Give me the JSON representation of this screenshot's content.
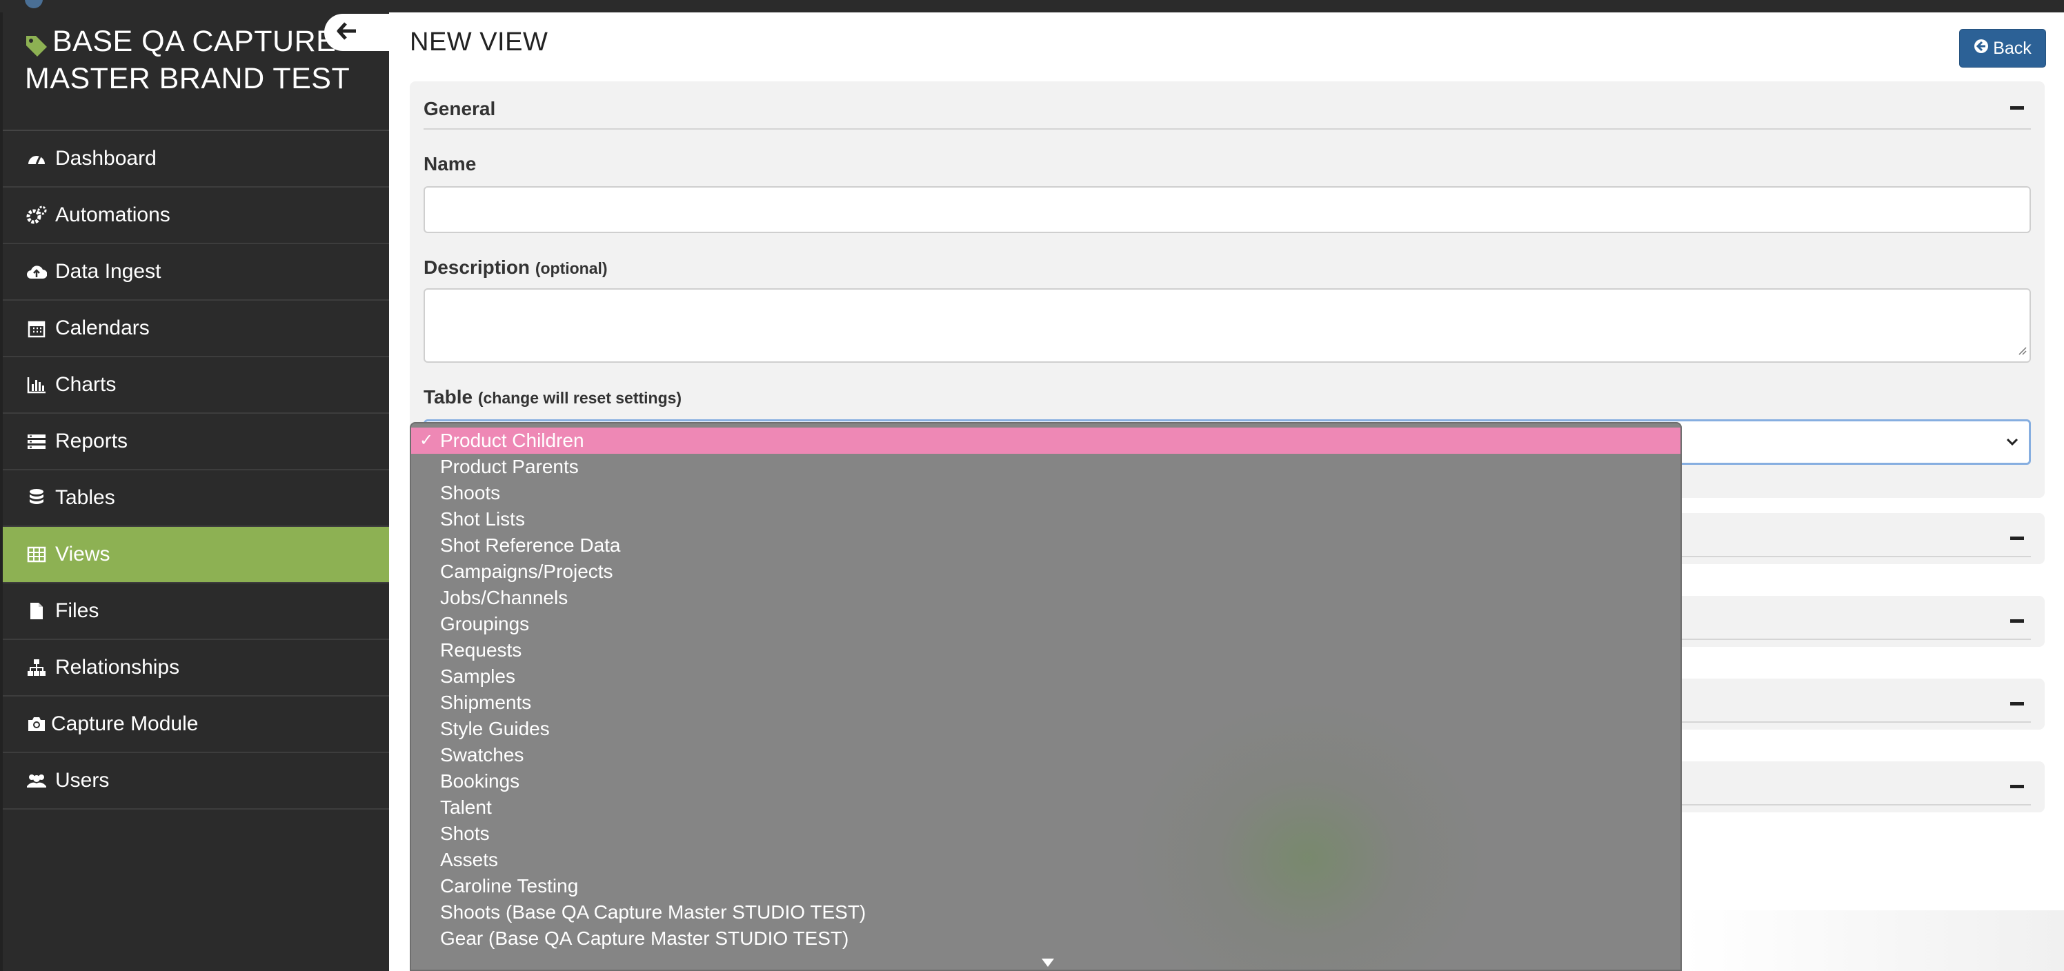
{
  "app": {
    "brand_title": "BASE QA CAPTURE MASTER BRAND TEST"
  },
  "sidebar": {
    "items": [
      {
        "label": "Dashboard",
        "icon": "dashboard-icon"
      },
      {
        "label": "Automations",
        "icon": "gears-icon"
      },
      {
        "label": "Data Ingest",
        "icon": "cloud-upload-icon"
      },
      {
        "label": "Calendars",
        "icon": "calendar-icon"
      },
      {
        "label": "Charts",
        "icon": "bar-chart-icon"
      },
      {
        "label": "Reports",
        "icon": "list-icon"
      },
      {
        "label": "Tables",
        "icon": "database-icon"
      },
      {
        "label": "Views",
        "icon": "table-icon",
        "active": true
      },
      {
        "label": "Files",
        "icon": "file-icon"
      },
      {
        "label": "Relationships",
        "icon": "sitemap-icon"
      },
      {
        "label": "Capture Module",
        "icon": "camera-icon"
      },
      {
        "label": "Users",
        "icon": "users-icon"
      }
    ],
    "active_color": "#8db153"
  },
  "header": {
    "title": "NEW VIEW",
    "back_label": "Back"
  },
  "form": {
    "section_title": "General",
    "name_label": "Name",
    "name_value": "",
    "description_label": "Description",
    "description_hint": "(optional)",
    "description_value": "",
    "table_label": "Table",
    "table_hint": "(change will reset settings)",
    "table_selected": "Product Children"
  },
  "dropdown": {
    "check_glyph": "✓",
    "options": [
      "Product Children",
      "Product Parents",
      "Shoots",
      "Shot Lists",
      "Shot Reference Data",
      "Campaigns/Projects",
      "Jobs/Channels",
      "Groupings",
      "Requests",
      "Samples",
      "Shipments",
      "Style Guides",
      "Swatches",
      "Bookings",
      "Talent",
      "Shots",
      "Assets",
      "Caroline Testing",
      "Shoots (Base QA Capture Master STUDIO TEST)",
      "Gear (Base QA Capture Master STUDIO TEST)"
    ],
    "selected_index": 0,
    "highlight_color": "#ee88b5"
  }
}
